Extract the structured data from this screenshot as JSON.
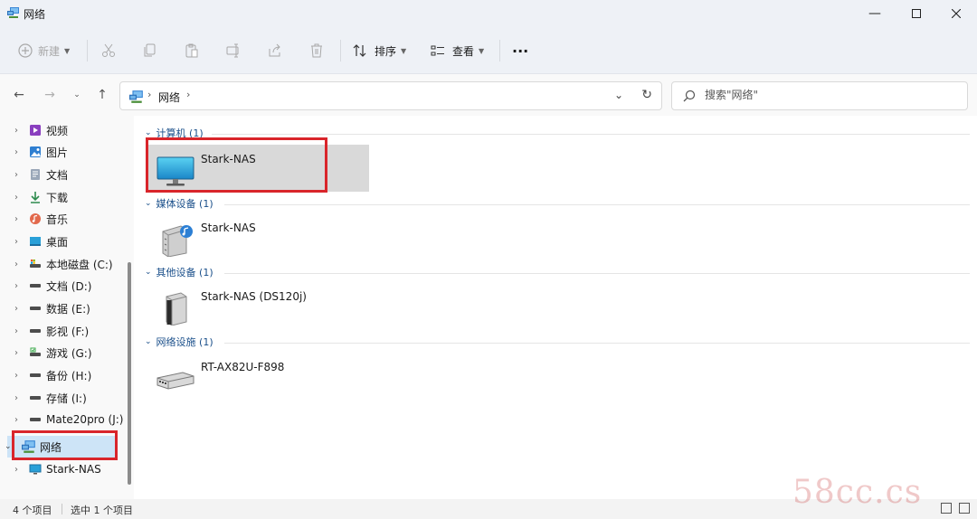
{
  "window": {
    "title": "网络",
    "controls": [
      "minimize-icon",
      "maximize-icon",
      "close-icon"
    ]
  },
  "toolbar": {
    "new_label": "新建",
    "sort_label": "排序",
    "view_label": "查看",
    "more_label": "···",
    "icons": [
      "cut-icon",
      "copy-icon",
      "paste-icon",
      "rename-icon",
      "share-icon",
      "delete-icon"
    ]
  },
  "address": {
    "crumb": "网络",
    "search_placeholder": "搜索\"网络\""
  },
  "nav": {
    "items": [
      {
        "label": "视频",
        "icon": "videos-icon"
      },
      {
        "label": "图片",
        "icon": "pictures-icon"
      },
      {
        "label": "文档",
        "icon": "documents-icon"
      },
      {
        "label": "下载",
        "icon": "downloads-icon"
      },
      {
        "label": "音乐",
        "icon": "music-icon"
      },
      {
        "label": "桌面",
        "icon": "desktop-icon"
      },
      {
        "label": "本地磁盘 (C:)",
        "icon": "system-drive-icon"
      },
      {
        "label": "文档 (D:)",
        "icon": "drive-icon"
      },
      {
        "label": "数据 (E:)",
        "icon": "drive-icon"
      },
      {
        "label": "影视 (F:)",
        "icon": "drive-icon"
      },
      {
        "label": "游戏 (G:)",
        "icon": "drive-icon"
      },
      {
        "label": "备份 (H:)",
        "icon": "drive-icon"
      },
      {
        "label": "存储 (I:)",
        "icon": "drive-icon"
      },
      {
        "label": "Mate20pro (J:)",
        "icon": "drive-icon"
      }
    ],
    "network_label": "网络",
    "network_child_label": "Stark-NAS"
  },
  "content": {
    "groups": [
      {
        "header": "计算机 (1)",
        "item": {
          "label": "Stark-NAS",
          "icon": "computer-icon"
        }
      },
      {
        "header": "媒体设备 (1)",
        "item": {
          "label": "Stark-NAS",
          "icon": "media-device-icon"
        }
      },
      {
        "header": "其他设备 (1)",
        "item": {
          "label": "Stark-NAS (DS120j)",
          "icon": "nas-device-icon"
        }
      },
      {
        "header": "网络设施 (1)",
        "item": {
          "label": "RT-AX82U-F898",
          "icon": "router-icon"
        }
      }
    ]
  },
  "status": {
    "count": "4 个项目",
    "selected": "选中 1 个项目"
  },
  "watermark": "58cc.cs",
  "colors": {
    "selection": "#cde4f7",
    "highlight_box": "#d9252b",
    "group_header": "#1a4f8a"
  }
}
